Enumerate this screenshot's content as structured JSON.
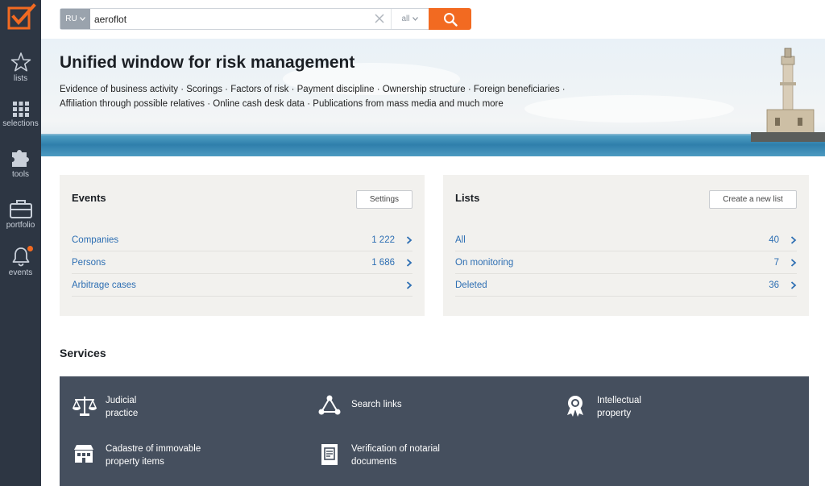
{
  "sidebar": {
    "items": [
      {
        "label": "lists",
        "icon": "star-icon"
      },
      {
        "label": "selections",
        "icon": "grid-icon"
      },
      {
        "label": "tools",
        "icon": "puzzle-icon"
      },
      {
        "label": "portfolio",
        "icon": "briefcase-icon"
      },
      {
        "label": "events",
        "icon": "bell-icon"
      }
    ]
  },
  "search": {
    "lang": "RU",
    "value": "aeroflot",
    "scope": "all"
  },
  "hero": {
    "title": "Unified window for risk management",
    "line1": "Evidence of business activity · Scorings · Factors of risk · Payment discipline · Ownership structure · Foreign beneficiaries ·",
    "line2": "Affiliation through possible relatives · Online cash desk data · Publications from mass media and much more"
  },
  "events": {
    "title": "Events",
    "button": "Settings",
    "rows": [
      {
        "label": "Companies",
        "count": "1 222"
      },
      {
        "label": "Persons",
        "count": "1 686"
      },
      {
        "label": "Arbitrage cases",
        "count": ""
      }
    ]
  },
  "lists": {
    "title": "Lists",
    "button": "Create a new list",
    "rows": [
      {
        "label": "All",
        "count": "40"
      },
      {
        "label": "On monitoring",
        "count": "7"
      },
      {
        "label": "Deleted",
        "count": "36"
      }
    ]
  },
  "services": {
    "title": "Services",
    "items": [
      {
        "line1": "Judicial",
        "line2": "practice",
        "icon": "scales-icon"
      },
      {
        "line1": "Search links",
        "line2": "",
        "icon": "links-icon"
      },
      {
        "line1": "Intellectual",
        "line2": "property",
        "icon": "award-icon"
      },
      {
        "line1": "Cadastre of immovable",
        "line2": "property items",
        "icon": "building-icon"
      },
      {
        "line1": "Verification of notarial",
        "line2": "documents",
        "icon": "document-icon"
      }
    ]
  },
  "colors": {
    "accent": "#f26a21",
    "sidebar": "#2d3643",
    "link": "#2e6fb3",
    "services_bg": "#454f5e"
  }
}
